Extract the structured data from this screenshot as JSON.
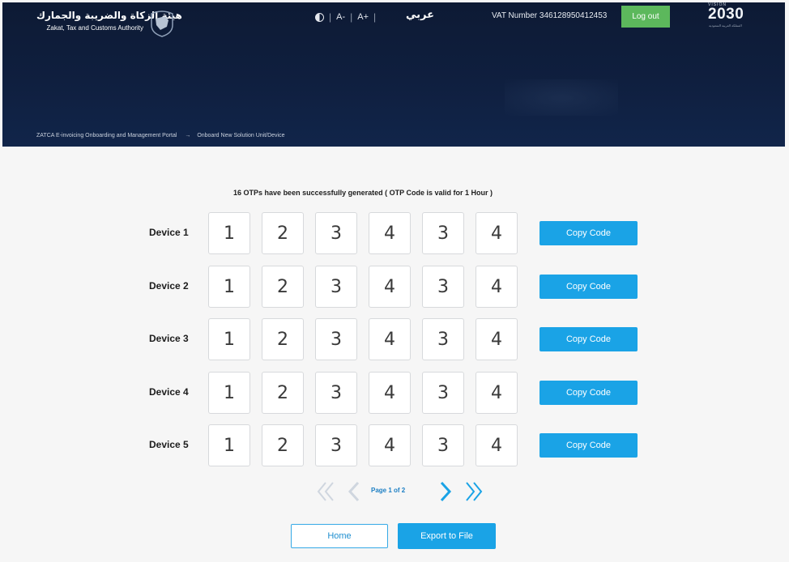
{
  "header": {
    "authority_name_ar": "هيئة الزكاة والضريبة والجمارك",
    "authority_name_en": "Zakat, Tax and Customs Authority",
    "language_toggle": "عربي",
    "vat_label": "VAT Number 346128950412453",
    "logout_label": "Log out",
    "vision": {
      "top": "VISION",
      "year": "2030",
      "sub": "المملكة العربية السعودية"
    }
  },
  "a11y": {
    "decrease_font": "A-",
    "increase_font": "A+"
  },
  "breadcrumb": {
    "items": [
      "ZATCA E-invoicing Onboarding and Management Portal",
      "Onboard New Solution Unit/Device"
    ],
    "separator": "→"
  },
  "main": {
    "message": "16 OTPs have been successfully generated  ( OTP Code is valid for 1 Hour )",
    "copy_label": "Copy Code",
    "devices": [
      {
        "label": "Device 1",
        "digits": [
          "1",
          "2",
          "3",
          "4",
          "3",
          "4"
        ]
      },
      {
        "label": "Device 2",
        "digits": [
          "1",
          "2",
          "3",
          "4",
          "3",
          "4"
        ]
      },
      {
        "label": "Device 3",
        "digits": [
          "1",
          "2",
          "3",
          "4",
          "3",
          "4"
        ]
      },
      {
        "label": "Device 4",
        "digits": [
          "1",
          "2",
          "3",
          "4",
          "3",
          "4"
        ]
      },
      {
        "label": "Device 5",
        "digits": [
          "1",
          "2",
          "3",
          "4",
          "3",
          "4"
        ]
      }
    ]
  },
  "pagination": {
    "page_info": "Page 1 of 2",
    "current_page": 1,
    "total_pages": 2
  },
  "footer": {
    "home_label": "Home",
    "export_label": "Export to File"
  },
  "colors": {
    "header_bg": "#0f1f3f",
    "accent_blue": "#1aa3e6",
    "logout_green": "#5cb85c",
    "page_bg": "#f6f6f6"
  }
}
